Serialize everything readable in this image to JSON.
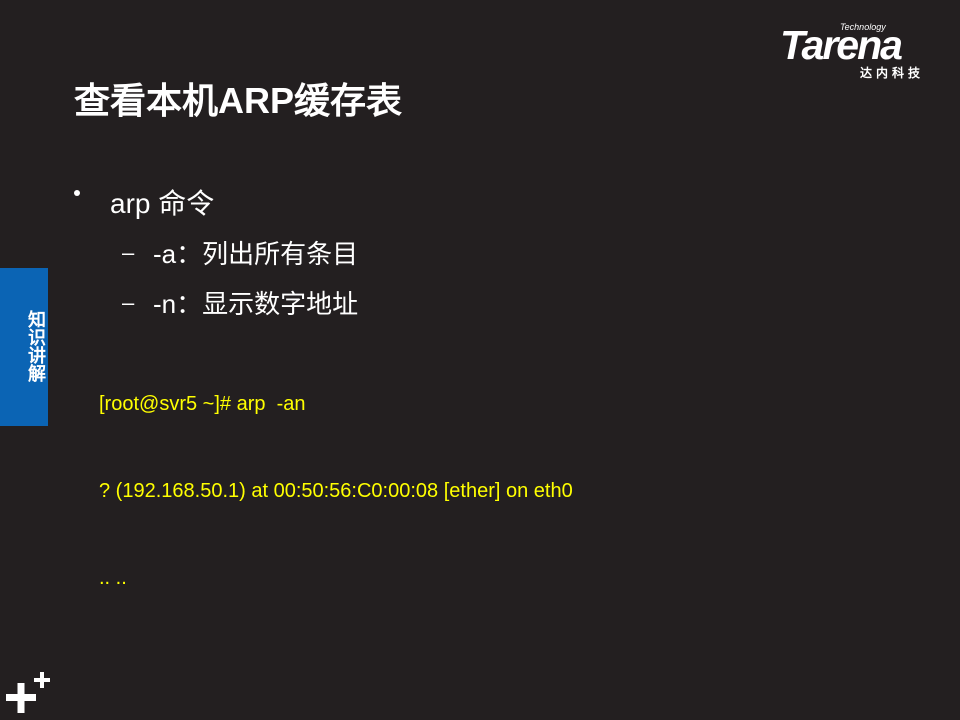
{
  "logo": {
    "small": "Technology",
    "main": "Tarena",
    "cn": "达内科技"
  },
  "title": "查看本机ARP缓存表",
  "side_tab": {
    "label": "知识讲解"
  },
  "bullet": {
    "text": "arp 命令",
    "sub_items": [
      {
        "dash": "–",
        "text": "-a：列出所有条目"
      },
      {
        "dash": "–",
        "text": "-n：显示数字地址"
      }
    ]
  },
  "terminal": {
    "lines": [
      "[root@svr5 ~]# arp  -an",
      "? (192.168.50.1) at 00:50:56:C0:00:08 [ether] on eth0",
      ".. .."
    ]
  },
  "colors": {
    "background": "#231f20",
    "accent_blue": "#0b64b4",
    "terminal_text": "#ffff00"
  },
  "icons": {
    "bottom_left": "plus-plus-icon"
  }
}
